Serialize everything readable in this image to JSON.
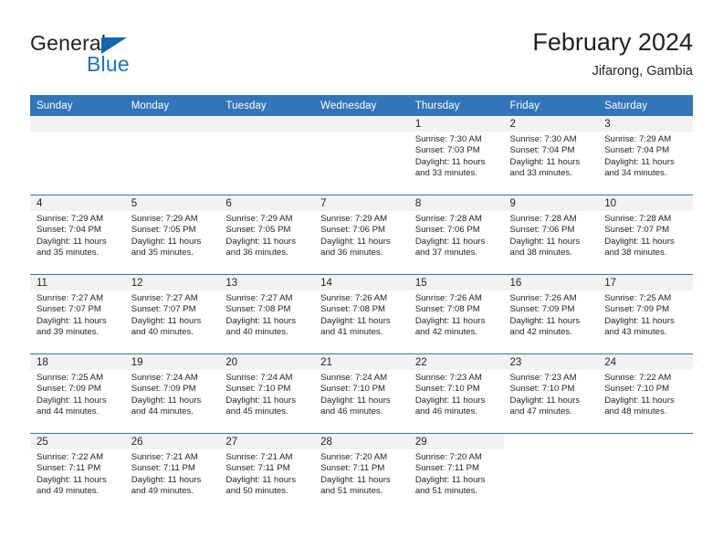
{
  "brand": {
    "name_top": "General",
    "name_bottom": "Blue",
    "triangle_color": "#1466b0",
    "blue_color": "#1b75bb"
  },
  "header": {
    "title": "February 2024",
    "subtitle": "Jifarong, Gambia"
  },
  "theme": {
    "header_blue": "#3275b9",
    "row_band_gray": "#f2f2f2",
    "text": "#231f20"
  },
  "weekday_headers": [
    "Sunday",
    "Monday",
    "Tuesday",
    "Wednesday",
    "Thursday",
    "Friday",
    "Saturday"
  ],
  "labels": {
    "sunrise_prefix": "Sunrise:",
    "sunset_prefix": "Sunset:",
    "daylight_prefix": "Daylight:"
  },
  "weeks": [
    [
      {
        "empty": true
      },
      {
        "empty": true
      },
      {
        "empty": true
      },
      {
        "empty": true
      },
      {
        "day": "1",
        "sunrise": "Sunrise: 7:30 AM",
        "sunset": "Sunset: 7:03 PM",
        "daylight1": "Daylight: 11 hours",
        "daylight2": "and 33 minutes."
      },
      {
        "day": "2",
        "sunrise": "Sunrise: 7:30 AM",
        "sunset": "Sunset: 7:04 PM",
        "daylight1": "Daylight: 11 hours",
        "daylight2": "and 33 minutes."
      },
      {
        "day": "3",
        "sunrise": "Sunrise: 7:29 AM",
        "sunset": "Sunset: 7:04 PM",
        "daylight1": "Daylight: 11 hours",
        "daylight2": "and 34 minutes."
      }
    ],
    [
      {
        "day": "4",
        "sunrise": "Sunrise: 7:29 AM",
        "sunset": "Sunset: 7:04 PM",
        "daylight1": "Daylight: 11 hours",
        "daylight2": "and 35 minutes."
      },
      {
        "day": "5",
        "sunrise": "Sunrise: 7:29 AM",
        "sunset": "Sunset: 7:05 PM",
        "daylight1": "Daylight: 11 hours",
        "daylight2": "and 35 minutes."
      },
      {
        "day": "6",
        "sunrise": "Sunrise: 7:29 AM",
        "sunset": "Sunset: 7:05 PM",
        "daylight1": "Daylight: 11 hours",
        "daylight2": "and 36 minutes."
      },
      {
        "day": "7",
        "sunrise": "Sunrise: 7:29 AM",
        "sunset": "Sunset: 7:06 PM",
        "daylight1": "Daylight: 11 hours",
        "daylight2": "and 36 minutes."
      },
      {
        "day": "8",
        "sunrise": "Sunrise: 7:28 AM",
        "sunset": "Sunset: 7:06 PM",
        "daylight1": "Daylight: 11 hours",
        "daylight2": "and 37 minutes."
      },
      {
        "day": "9",
        "sunrise": "Sunrise: 7:28 AM",
        "sunset": "Sunset: 7:06 PM",
        "daylight1": "Daylight: 11 hours",
        "daylight2": "and 38 minutes."
      },
      {
        "day": "10",
        "sunrise": "Sunrise: 7:28 AM",
        "sunset": "Sunset: 7:07 PM",
        "daylight1": "Daylight: 11 hours",
        "daylight2": "and 38 minutes."
      }
    ],
    [
      {
        "day": "11",
        "sunrise": "Sunrise: 7:27 AM",
        "sunset": "Sunset: 7:07 PM",
        "daylight1": "Daylight: 11 hours",
        "daylight2": "and 39 minutes."
      },
      {
        "day": "12",
        "sunrise": "Sunrise: 7:27 AM",
        "sunset": "Sunset: 7:07 PM",
        "daylight1": "Daylight: 11 hours",
        "daylight2": "and 40 minutes."
      },
      {
        "day": "13",
        "sunrise": "Sunrise: 7:27 AM",
        "sunset": "Sunset: 7:08 PM",
        "daylight1": "Daylight: 11 hours",
        "daylight2": "and 40 minutes."
      },
      {
        "day": "14",
        "sunrise": "Sunrise: 7:26 AM",
        "sunset": "Sunset: 7:08 PM",
        "daylight1": "Daylight: 11 hours",
        "daylight2": "and 41 minutes."
      },
      {
        "day": "15",
        "sunrise": "Sunrise: 7:26 AM",
        "sunset": "Sunset: 7:08 PM",
        "daylight1": "Daylight: 11 hours",
        "daylight2": "and 42 minutes."
      },
      {
        "day": "16",
        "sunrise": "Sunrise: 7:26 AM",
        "sunset": "Sunset: 7:09 PM",
        "daylight1": "Daylight: 11 hours",
        "daylight2": "and 42 minutes."
      },
      {
        "day": "17",
        "sunrise": "Sunrise: 7:25 AM",
        "sunset": "Sunset: 7:09 PM",
        "daylight1": "Daylight: 11 hours",
        "daylight2": "and 43 minutes."
      }
    ],
    [
      {
        "day": "18",
        "sunrise": "Sunrise: 7:25 AM",
        "sunset": "Sunset: 7:09 PM",
        "daylight1": "Daylight: 11 hours",
        "daylight2": "and 44 minutes."
      },
      {
        "day": "19",
        "sunrise": "Sunrise: 7:24 AM",
        "sunset": "Sunset: 7:09 PM",
        "daylight1": "Daylight: 11 hours",
        "daylight2": "and 44 minutes."
      },
      {
        "day": "20",
        "sunrise": "Sunrise: 7:24 AM",
        "sunset": "Sunset: 7:10 PM",
        "daylight1": "Daylight: 11 hours",
        "daylight2": "and 45 minutes."
      },
      {
        "day": "21",
        "sunrise": "Sunrise: 7:24 AM",
        "sunset": "Sunset: 7:10 PM",
        "daylight1": "Daylight: 11 hours",
        "daylight2": "and 46 minutes."
      },
      {
        "day": "22",
        "sunrise": "Sunrise: 7:23 AM",
        "sunset": "Sunset: 7:10 PM",
        "daylight1": "Daylight: 11 hours",
        "daylight2": "and 46 minutes."
      },
      {
        "day": "23",
        "sunrise": "Sunrise: 7:23 AM",
        "sunset": "Sunset: 7:10 PM",
        "daylight1": "Daylight: 11 hours",
        "daylight2": "and 47 minutes."
      },
      {
        "day": "24",
        "sunrise": "Sunrise: 7:22 AM",
        "sunset": "Sunset: 7:10 PM",
        "daylight1": "Daylight: 11 hours",
        "daylight2": "and 48 minutes."
      }
    ],
    [
      {
        "day": "25",
        "sunrise": "Sunrise: 7:22 AM",
        "sunset": "Sunset: 7:11 PM",
        "daylight1": "Daylight: 11 hours",
        "daylight2": "and 49 minutes."
      },
      {
        "day": "26",
        "sunrise": "Sunrise: 7:21 AM",
        "sunset": "Sunset: 7:11 PM",
        "daylight1": "Daylight: 11 hours",
        "daylight2": "and 49 minutes."
      },
      {
        "day": "27",
        "sunrise": "Sunrise: 7:21 AM",
        "sunset": "Sunset: 7:11 PM",
        "daylight1": "Daylight: 11 hours",
        "daylight2": "and 50 minutes."
      },
      {
        "day": "28",
        "sunrise": "Sunrise: 7:20 AM",
        "sunset": "Sunset: 7:11 PM",
        "daylight1": "Daylight: 11 hours",
        "daylight2": "and 51 minutes."
      },
      {
        "day": "29",
        "sunrise": "Sunrise: 7:20 AM",
        "sunset": "Sunset: 7:11 PM",
        "daylight1": "Daylight: 11 hours",
        "daylight2": "and 51 minutes."
      },
      {
        "blank": true
      },
      {
        "blank": true
      }
    ]
  ]
}
